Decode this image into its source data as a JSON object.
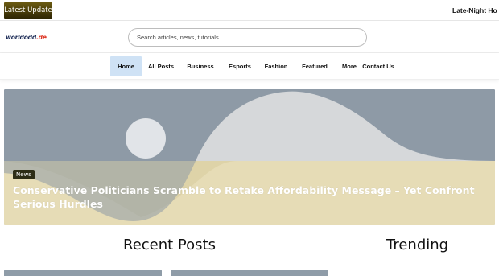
{
  "topbar": {
    "latest_label": "Latest Update",
    "ticker": "Late-Night Ho"
  },
  "header": {
    "logo_text": "worldodd",
    "logo_suffix": ".de",
    "search_placeholder": "Search articles, news, tutorials..."
  },
  "nav": {
    "items": [
      {
        "label": "Home",
        "active": true
      },
      {
        "label": "All Posts"
      },
      {
        "label": "Business"
      },
      {
        "label": "Esports"
      },
      {
        "label": "Fashion"
      },
      {
        "label": "Featured"
      },
      {
        "label": "More"
      },
      {
        "label": "Contact Us"
      }
    ]
  },
  "hero": {
    "category": "News",
    "title": "Conservative Politicians Scramble to Retake Affordability Message – Yet Confront Serious Hurdles"
  },
  "sections": {
    "recent": "Recent Posts",
    "trending": "Trending"
  },
  "colors": {
    "accent_active": "#cfe2f5",
    "badge_bg": "#2d2d16",
    "placeholder_sky": "#8e9aa6",
    "placeholder_sand": "#e6dcb6"
  }
}
